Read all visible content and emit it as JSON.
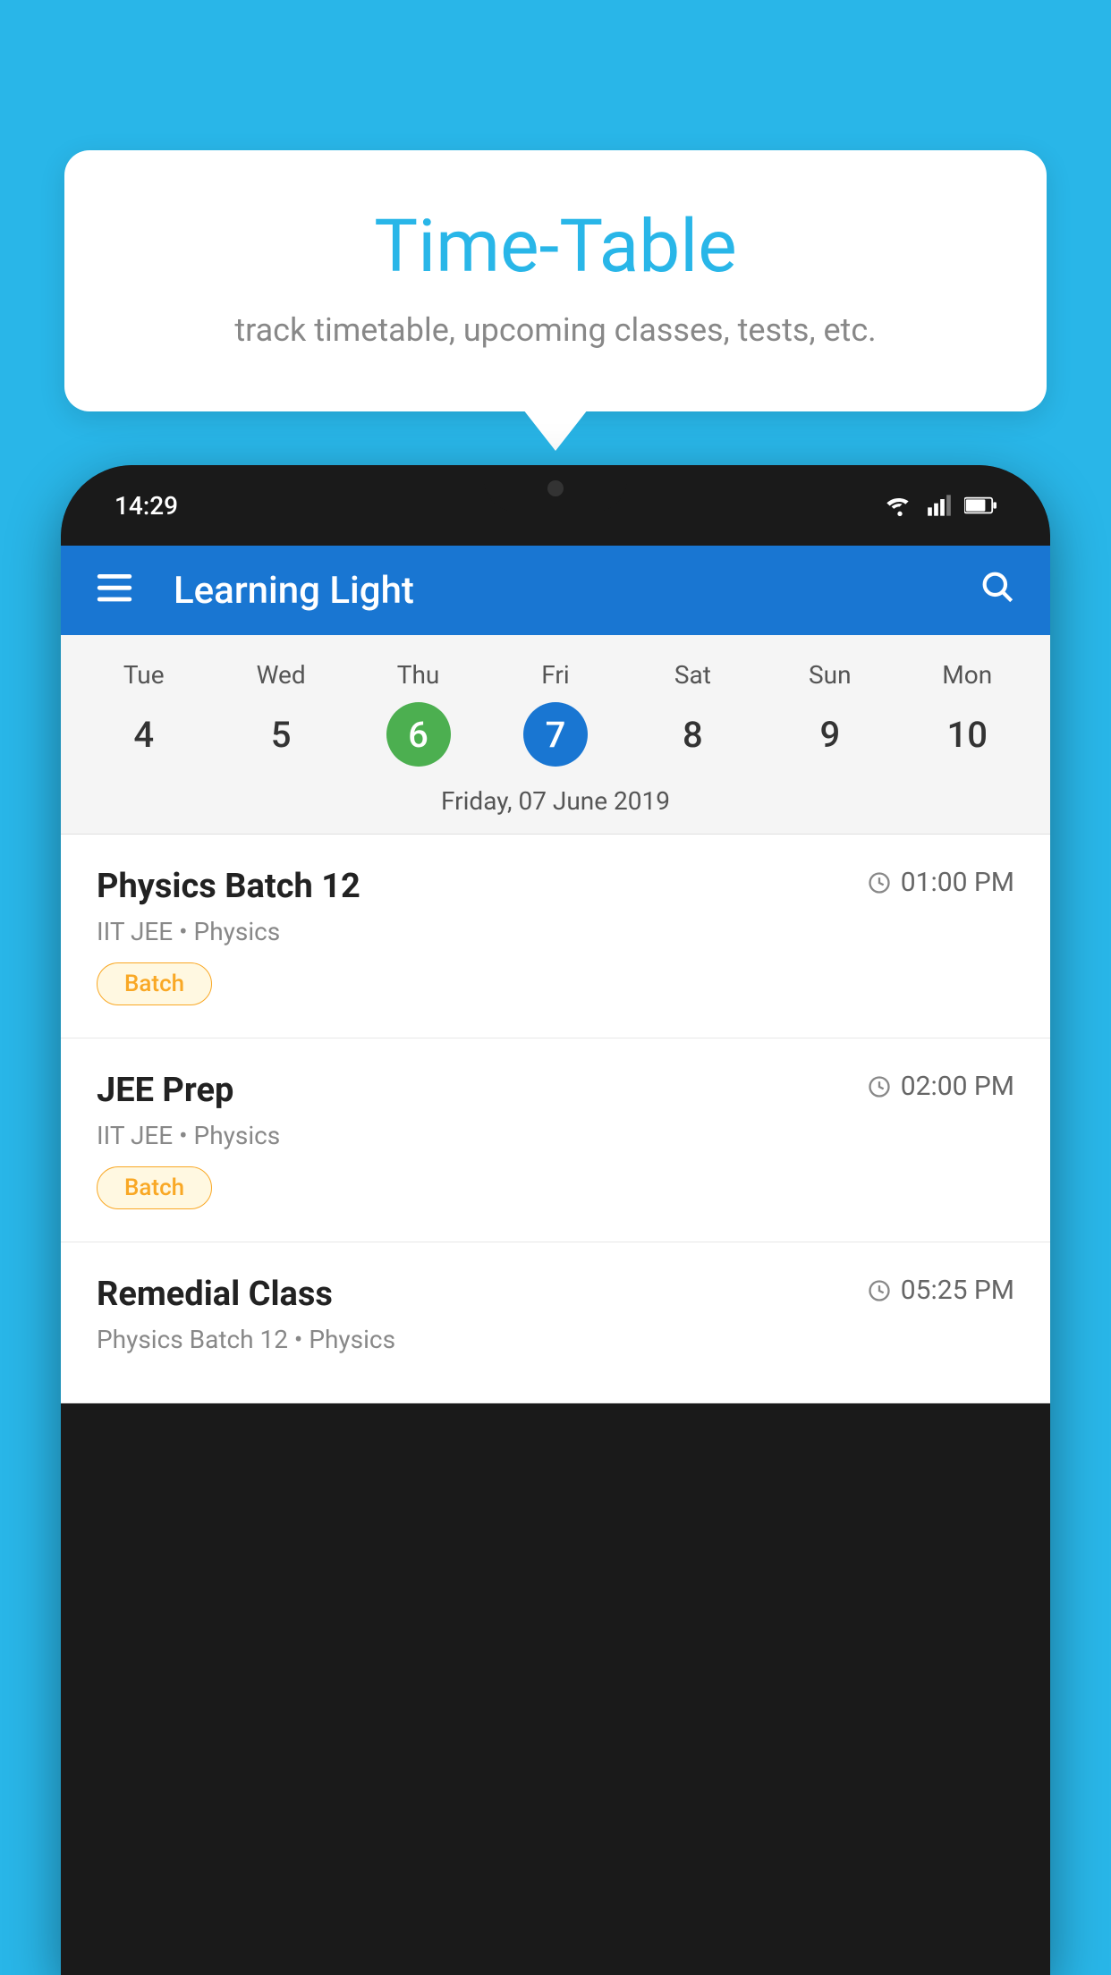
{
  "background_color": "#29B6E8",
  "bubble": {
    "title": "Time-Table",
    "subtitle": "track timetable, upcoming classes, tests, etc."
  },
  "phone": {
    "status_bar": {
      "time": "14:29",
      "icons": [
        "wifi",
        "signal",
        "battery"
      ]
    },
    "app_bar": {
      "title": "Learning Light",
      "menu_icon": "≡",
      "search_icon": "🔍"
    },
    "calendar": {
      "days": [
        {
          "name": "Tue",
          "number": "4",
          "state": "normal"
        },
        {
          "name": "Wed",
          "number": "5",
          "state": "normal"
        },
        {
          "name": "Thu",
          "number": "6",
          "state": "today"
        },
        {
          "name": "Fri",
          "number": "7",
          "state": "selected"
        },
        {
          "name": "Sat",
          "number": "8",
          "state": "normal"
        },
        {
          "name": "Sun",
          "number": "9",
          "state": "normal"
        },
        {
          "name": "Mon",
          "number": "10",
          "state": "normal"
        }
      ],
      "selected_date_label": "Friday, 07 June 2019"
    },
    "schedule": [
      {
        "title": "Physics Batch 12",
        "time": "01:00 PM",
        "subtitle": "IIT JEE • Physics",
        "badge": "Batch"
      },
      {
        "title": "JEE Prep",
        "time": "02:00 PM",
        "subtitle": "IIT JEE • Physics",
        "badge": "Batch"
      },
      {
        "title": "Remedial Class",
        "time": "05:25 PM",
        "subtitle": "Physics Batch 12 • Physics",
        "badge": ""
      }
    ]
  }
}
